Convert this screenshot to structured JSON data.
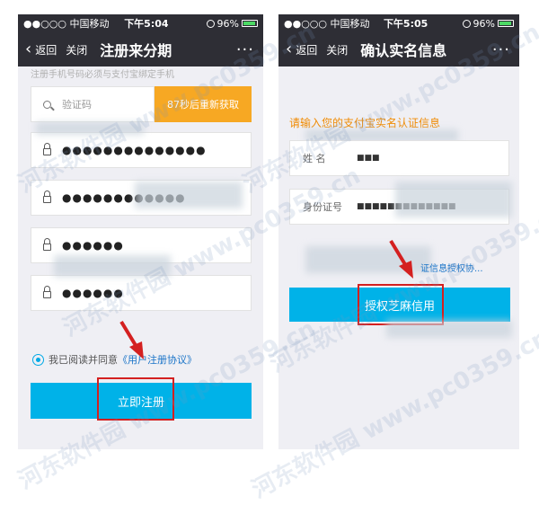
{
  "status": {
    "carrier": "●●○○○ 中国移动",
    "battery": "96%"
  },
  "left": {
    "time": "下午5:04",
    "back_label": "返回",
    "close_label": "关闭",
    "title": "注册来分期",
    "more_label": "···",
    "top_hint": "注册手机号码必须与支付宝绑定手机",
    "code_placeholder": "验证码",
    "resend_label": "87秒后重新获取",
    "password_mask_1": "●●●●●●●●●●●●●●",
    "password_mask_2": "●●●●●●●●●●●●",
    "pin_mask_1": "●●●●●●",
    "pin_mask_2": "●●●●●●",
    "agree_text": "我已阅读并同意",
    "agree_link": "《用户注册协议》",
    "register_label": "立即注册"
  },
  "right": {
    "time": "下午5:05",
    "back_label": "返回",
    "close_label": "关闭",
    "title": "确认实名信息",
    "more_label": "···",
    "section_tip": "请输入您的支付宝实名认证信息",
    "name_label": "姓 名",
    "name_value": "■■■",
    "id_label": "身份证号",
    "id_value": "■■■■■■■■■■■■■",
    "agreement_link": "证信息授权协...",
    "auth_label": "授权芝麻信用"
  },
  "watermark": "河东软件园 www.pc0359.cn",
  "colors": {
    "nav": "#2e2e35",
    "primary": "#00b2e8",
    "orange": "#f7a823",
    "highlight": "#d42020"
  }
}
